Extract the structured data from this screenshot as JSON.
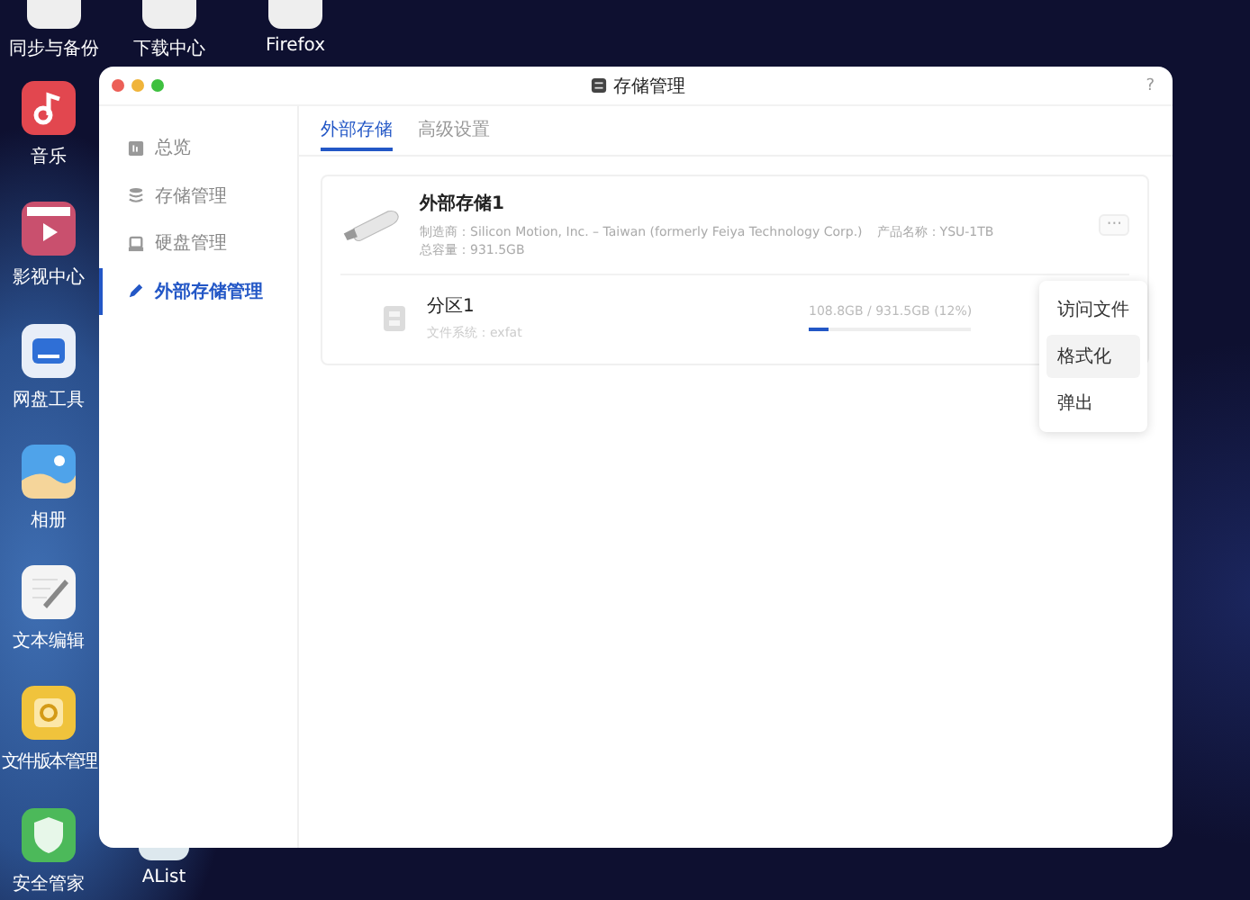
{
  "desktop": {
    "top_apps": [
      {
        "label": "同步与备份",
        "kind": "generic"
      },
      {
        "label": "下载中心",
        "kind": "generic"
      },
      {
        "label": "Firefox",
        "kind": "generic"
      }
    ],
    "side_apps": [
      {
        "label": "音乐",
        "kind": "music"
      },
      {
        "label": "影视中心",
        "kind": "video"
      },
      {
        "label": "网盘工具",
        "kind": "netdisk"
      },
      {
        "label": "相册",
        "kind": "photos"
      },
      {
        "label": "文本编辑",
        "kind": "editor"
      },
      {
        "label": "文件版本管理",
        "kind": "versions"
      },
      {
        "label": "安全管家",
        "kind": "security"
      }
    ],
    "bottom_app": {
      "label": "AList"
    }
  },
  "window": {
    "title": "存储管理",
    "help": "?"
  },
  "sidebar": {
    "items": [
      {
        "label": "总览",
        "kind": "overview",
        "selected": false
      },
      {
        "label": "存储管理",
        "kind": "storage",
        "selected": false
      },
      {
        "label": "硬盘管理",
        "kind": "disk",
        "selected": false
      },
      {
        "label": "外部存储管理",
        "kind": "external",
        "selected": true
      }
    ]
  },
  "tabs": [
    {
      "label": "外部存储",
      "selected": true
    },
    {
      "label": "高级设置",
      "selected": false
    }
  ],
  "device": {
    "name": "外部存储1",
    "details": [
      "制造商：Silicon Motion, Inc. – Taiwan (formerly Feiya Technology Corp.)",
      "产品名称：YSU-1TB",
      "总容量：931.5GB"
    ],
    "more": "···",
    "partition": {
      "name": "分区1",
      "filesystem": "文件系统：exfat",
      "usage": "108.8GB / 931.5GB (12%)",
      "level": 0.12
    }
  },
  "menu": [
    {
      "label": "访问文件",
      "selected": false
    },
    {
      "label": "格式化",
      "selected": true
    },
    {
      "label": "弹出",
      "selected": false
    }
  ]
}
